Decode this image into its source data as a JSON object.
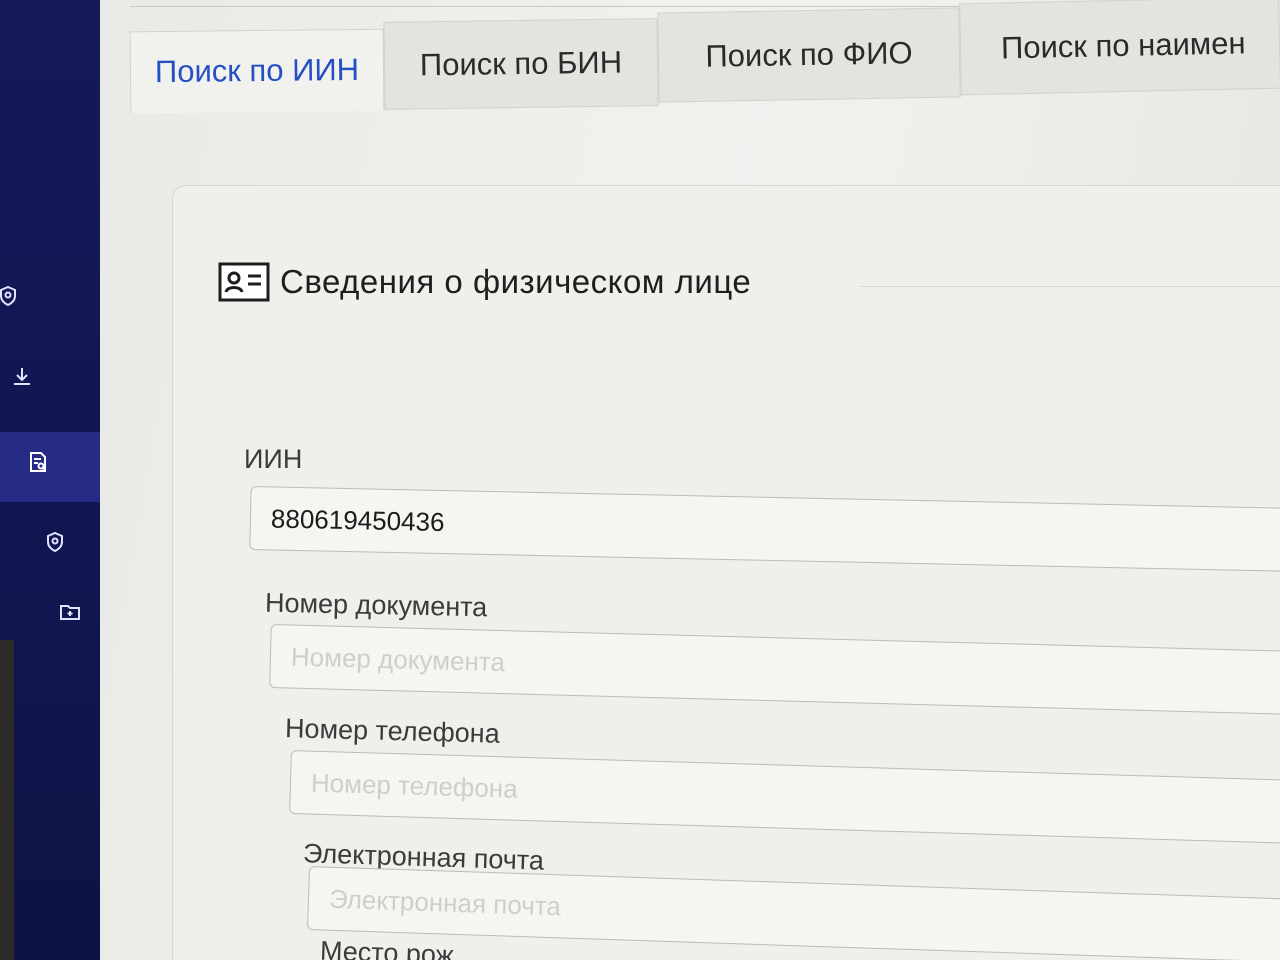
{
  "tabs": [
    {
      "label": "Поиск по ИИН",
      "active": true
    },
    {
      "label": "Поиск по БИН",
      "active": false
    },
    {
      "label": "Поиск по ФИО",
      "active": false
    },
    {
      "label": "Поиск по наимен",
      "active": false
    }
  ],
  "sidebar": {
    "items": [
      {
        "icon": "shield-icon"
      },
      {
        "icon": "download-icon"
      },
      {
        "icon": "document-search-icon",
        "active": true
      },
      {
        "icon": "shield-icon"
      },
      {
        "icon": "folder-icon"
      }
    ]
  },
  "section": {
    "title": "Сведения о физическом лице",
    "icon": "person-card-icon"
  },
  "form": {
    "iin": {
      "label": "ИИН",
      "value": "880619450436",
      "placeholder": ""
    },
    "doc": {
      "label": "Номер документа",
      "value": "",
      "placeholder": "Номер документа"
    },
    "phone": {
      "label": "Номер телефона",
      "value": "",
      "placeholder": "Номер телефона"
    },
    "email": {
      "label": "Электронная почта",
      "value": "",
      "placeholder": "Электронная почта"
    },
    "next_label": "Место рож"
  },
  "colors": {
    "sidebar_bg": "#15195a",
    "accent": "#2550c4"
  }
}
